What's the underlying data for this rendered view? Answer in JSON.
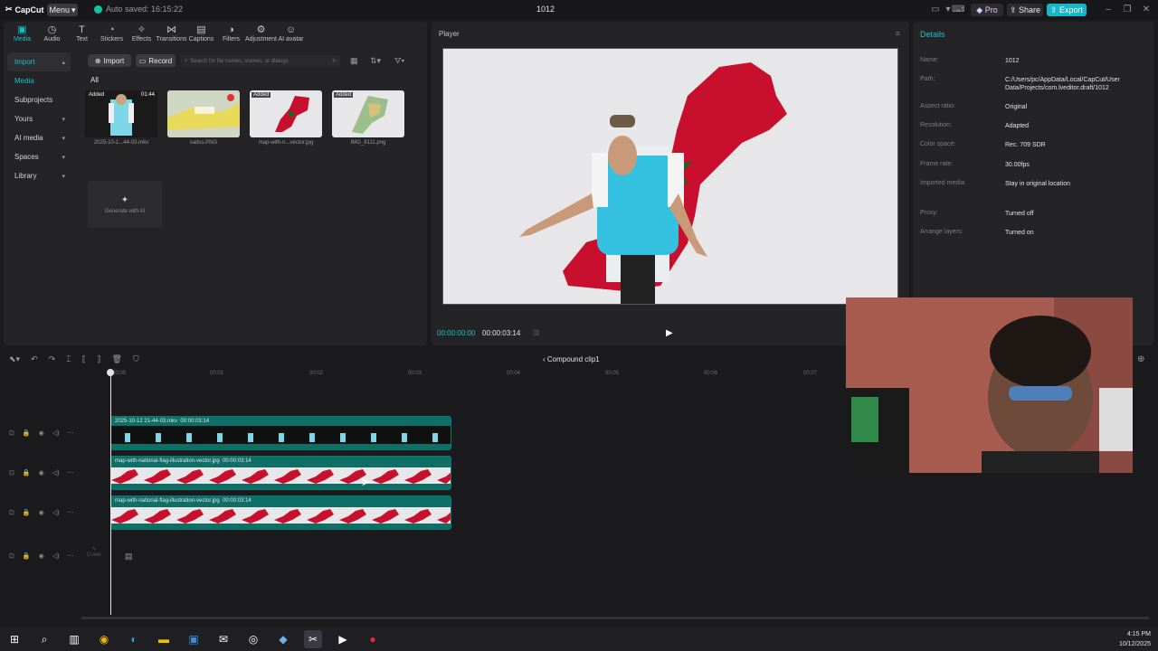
{
  "app": {
    "logo": "CapCut",
    "menu": "Menu",
    "autosave": "Auto saved: 16:15:22",
    "project_title": "1012",
    "pro": "Pro",
    "share": "Share",
    "export": "Export"
  },
  "toolbar": [
    {
      "label": "Media",
      "icon": "media-icon"
    },
    {
      "label": "Audio",
      "icon": "audio-icon"
    },
    {
      "label": "Text",
      "icon": "text-icon"
    },
    {
      "label": "Stickers",
      "icon": "sticker-icon"
    },
    {
      "label": "Effects",
      "icon": "effects-icon"
    },
    {
      "label": "Transitions",
      "icon": "transitions-icon"
    },
    {
      "label": "Captions",
      "icon": "captions-icon"
    },
    {
      "label": "Filters",
      "icon": "filters-icon"
    },
    {
      "label": "Adjustment",
      "icon": "adjustment-icon"
    },
    {
      "label": "AI avatar",
      "icon": "ai-avatar-icon"
    }
  ],
  "sidebar": [
    {
      "label": "Import"
    },
    {
      "label": "Media"
    },
    {
      "label": "Subprojects"
    },
    {
      "label": "Yours"
    },
    {
      "label": "AI media"
    },
    {
      "label": "Spaces"
    },
    {
      "label": "Library"
    }
  ],
  "media": {
    "import_btn": "Import",
    "record_btn": "Record",
    "search_placeholder": "Search for file names, scenes, or dialogs",
    "filter_all": "All",
    "items": [
      {
        "name": "2025-10-1...44-03.mkv",
        "badge": "Added",
        "duration": "01:44"
      },
      {
        "name": "sadss.PNG",
        "badge": "",
        "duration": ""
      },
      {
        "name": "map-with-n...vector.jpg",
        "badge": "Added",
        "duration": ""
      },
      {
        "name": "IMG_8111.png",
        "badge": "Added",
        "duration": ""
      }
    ],
    "generate_ai": "Generate with AI"
  },
  "player": {
    "title": "Player",
    "timecode_current": "00:00:00:00",
    "timecode_total": "00:00:03:14"
  },
  "details": {
    "title": "Details",
    "rows": [
      {
        "label": "Name:",
        "value": "1012"
      },
      {
        "label": "Path:",
        "value": "C:/Users/pc/AppData/Local/CapCut/User Data/Projects/com.lveditor.draft/1012"
      },
      {
        "label": "Aspect ratio:",
        "value": "Original"
      },
      {
        "label": "Resolution:",
        "value": "Adapted"
      },
      {
        "label": "Color space:",
        "value": "Rec. 709 SDR"
      },
      {
        "label": "Frame rate:",
        "value": "30.00fps"
      },
      {
        "label": "Imported media:",
        "value": "Stay in original location"
      },
      {
        "label": "Proxy:",
        "value": "Turned off"
      },
      {
        "label": "Arrange layers:",
        "value": "Turned on"
      }
    ]
  },
  "timeline": {
    "compound": "Compound clip1",
    "ruler": [
      "00:00",
      "00:01",
      "00:02",
      "00:03",
      "00:04",
      "00:05",
      "00:06",
      "00:07"
    ],
    "clips": [
      {
        "name": "2025-10-12 21-44-03.mkv",
        "duration": "00:00:03:14"
      },
      {
        "name": "map-with-national-flag-illustration-vector.jpg",
        "duration": "00:00:03:14"
      },
      {
        "name": "map-with-national-flag-illustration-vector.jpg",
        "duration": "00:00:03:14"
      }
    ],
    "cover": "Cover"
  },
  "taskbar": {
    "time": "4:15 PM",
    "date": "10/12/2025"
  },
  "colors": {
    "accent": "#17c1c8",
    "clip": "#0e6f66",
    "flag_red": "#c8102e",
    "flag_green": "#0a6b2c"
  }
}
